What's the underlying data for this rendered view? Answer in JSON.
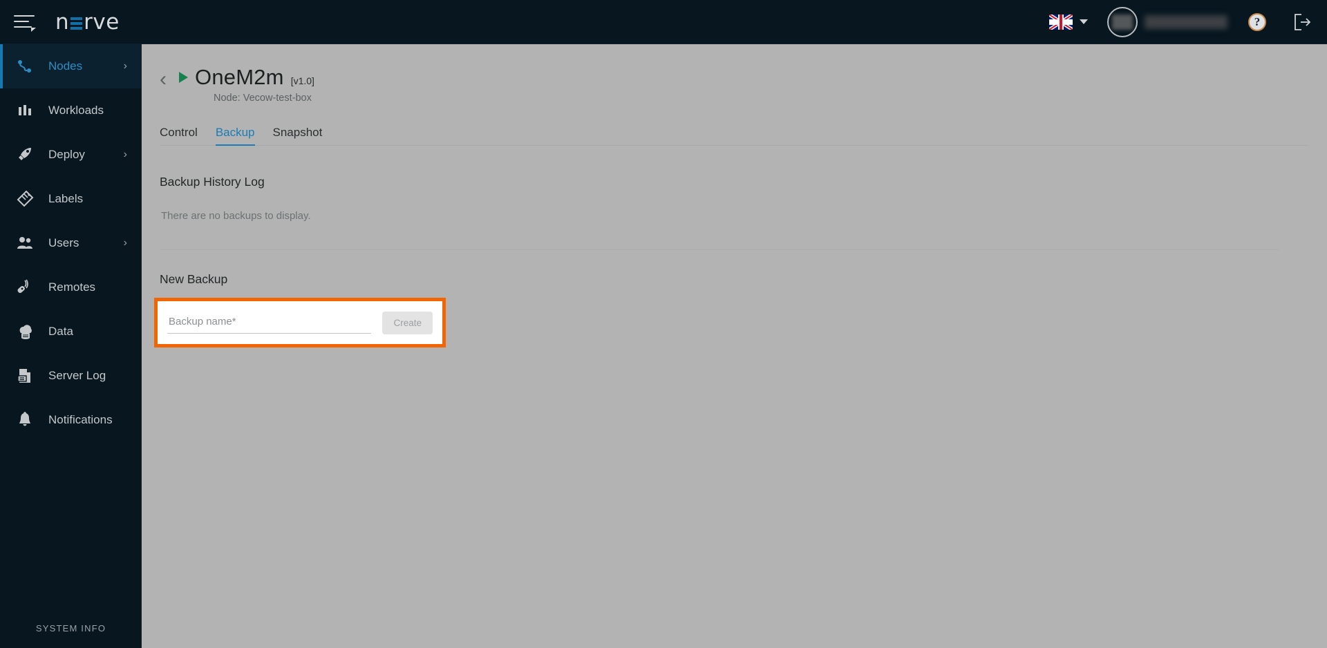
{
  "header": {
    "menu_icon": "hamburger-menu-icon",
    "logo_text_before": "n",
    "logo_text_after": "rve",
    "language_flag": "uk-flag-icon",
    "language_caret": "chevron-down-icon",
    "avatar": "user-avatar",
    "username": "",
    "help_label": "?",
    "logout_icon": "logout-icon"
  },
  "sidebar": {
    "items": [
      {
        "label": "Nodes",
        "icon": "nodes-icon",
        "active": true,
        "chevron": "›"
      },
      {
        "label": "Workloads",
        "icon": "workloads-icon",
        "active": false,
        "chevron": ""
      },
      {
        "label": "Deploy",
        "icon": "deploy-icon",
        "active": false,
        "chevron": "›"
      },
      {
        "label": "Labels",
        "icon": "labels-icon",
        "active": false,
        "chevron": ""
      },
      {
        "label": "Users",
        "icon": "users-icon",
        "active": false,
        "chevron": "›"
      },
      {
        "label": "Remotes",
        "icon": "remotes-icon",
        "active": false,
        "chevron": ""
      },
      {
        "label": "Data",
        "icon": "data-icon",
        "active": false,
        "chevron": ""
      },
      {
        "label": "Server Log",
        "icon": "server-log-icon",
        "active": false,
        "chevron": ""
      },
      {
        "label": "Notifications",
        "icon": "notifications-icon",
        "active": false,
        "chevron": ""
      }
    ],
    "system_info": "SYSTEM INFO"
  },
  "main": {
    "back_chevron": "‹",
    "title": "OneM2m",
    "version": "[v1.0]",
    "node_line": "Node: Vecow-test-box",
    "tabs": [
      {
        "label": "Control",
        "active": false
      },
      {
        "label": "Backup",
        "active": true
      },
      {
        "label": "Snapshot",
        "active": false
      }
    ],
    "history_title": "Backup History Log",
    "empty_message": "There are no backups to display.",
    "new_backup_title": "New Backup",
    "backup_name_placeholder": "Backup name*",
    "backup_name_value": "",
    "create_label": "Create"
  },
  "colors": {
    "header_bg": "#07161f",
    "sidebar_bg": "#08161f",
    "content_bg": "#b3b3b3",
    "accent_blue": "#1b7cb5",
    "highlight_orange": "#f26500",
    "play_green": "#17824f"
  }
}
